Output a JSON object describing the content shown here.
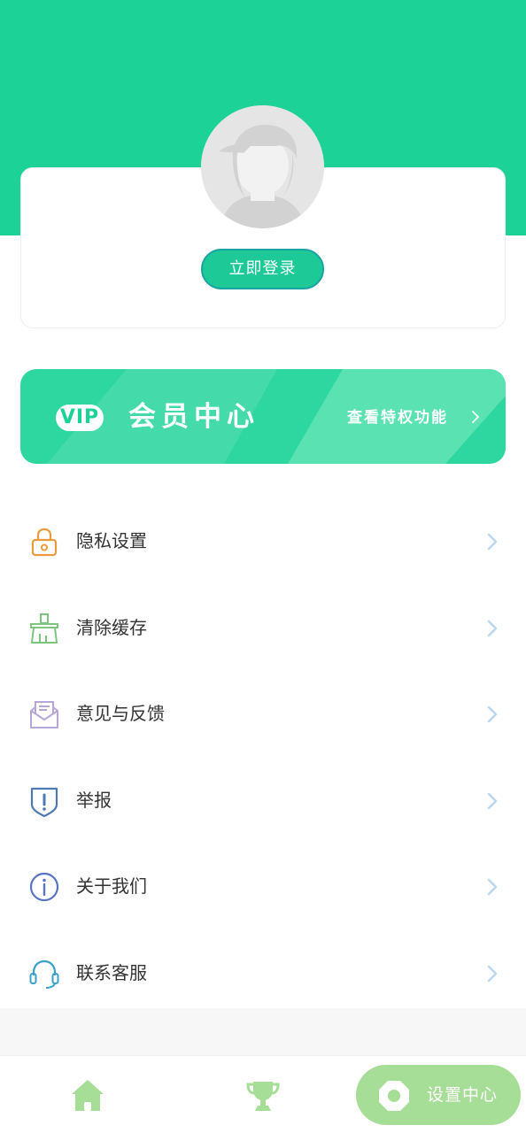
{
  "profile": {
    "login_label": "立即登录"
  },
  "vip": {
    "badge": "VIP",
    "title": "会员中心",
    "link": "查看特权功能"
  },
  "menu": {
    "items": [
      {
        "label": "隐私设置",
        "icon": "lock-icon",
        "color": "#e99a3c"
      },
      {
        "label": "清除缓存",
        "icon": "broom-icon",
        "color": "#7cc47f"
      },
      {
        "label": "意见与反馈",
        "icon": "envelope-icon",
        "color": "#b7a6d8"
      },
      {
        "label": "举报",
        "icon": "shield-alert-icon",
        "color": "#4e79b3"
      },
      {
        "label": "关于我们",
        "icon": "info-icon",
        "color": "#5a74c4"
      },
      {
        "label": "联系客服",
        "icon": "headset-icon",
        "color": "#3aa0c8"
      }
    ]
  },
  "tabbar": {
    "settings_label": "设置中心",
    "tabs": [
      "home-icon",
      "trophy-icon",
      "gear-icon"
    ]
  },
  "colors": {
    "brand": "#1dd296",
    "tab_accent": "#a6dd97",
    "chevron": "#bcd7ee"
  }
}
